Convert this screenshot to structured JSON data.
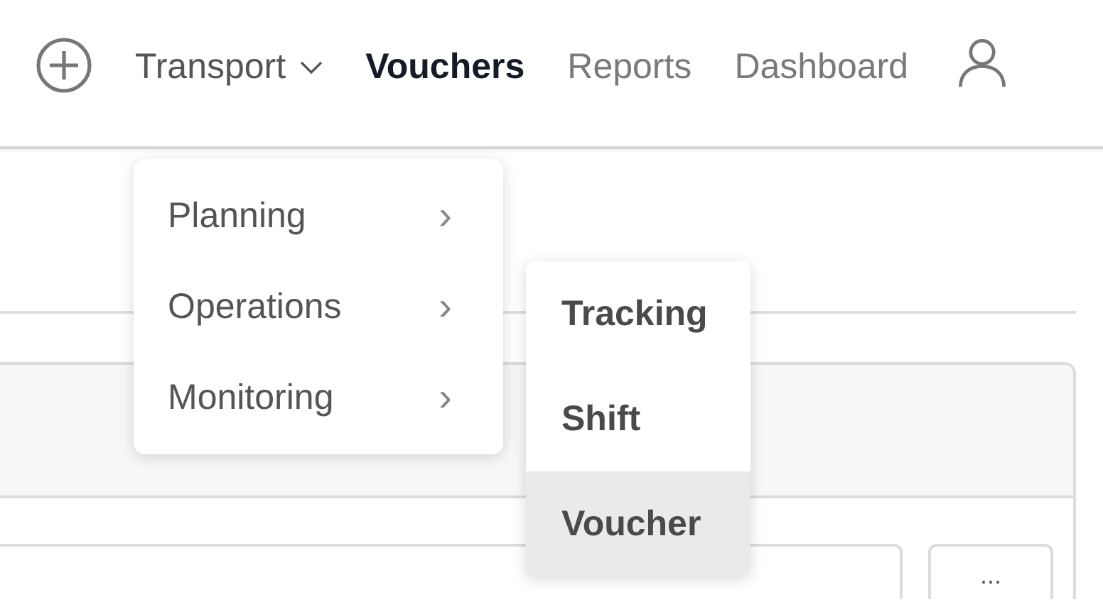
{
  "nav": {
    "items": [
      {
        "label": "Transport",
        "kind": "dropdown",
        "selected": false
      },
      {
        "label": "Vouchers",
        "kind": "link",
        "selected": true
      },
      {
        "label": "Reports",
        "kind": "link",
        "selected": false
      },
      {
        "label": "Dashboard",
        "kind": "link",
        "selected": false
      }
    ]
  },
  "menu": {
    "items": [
      {
        "label": "Planning",
        "chevron": "›"
      },
      {
        "label": "Operations",
        "chevron": "›"
      },
      {
        "label": "Monitoring",
        "chevron": "›"
      }
    ]
  },
  "submenu": {
    "items": [
      {
        "label": "Tracking",
        "selected": false
      },
      {
        "label": "Shift",
        "selected": false
      },
      {
        "label": "Voucher",
        "selected": true
      }
    ]
  },
  "toolbar": {
    "more_button": "..."
  }
}
